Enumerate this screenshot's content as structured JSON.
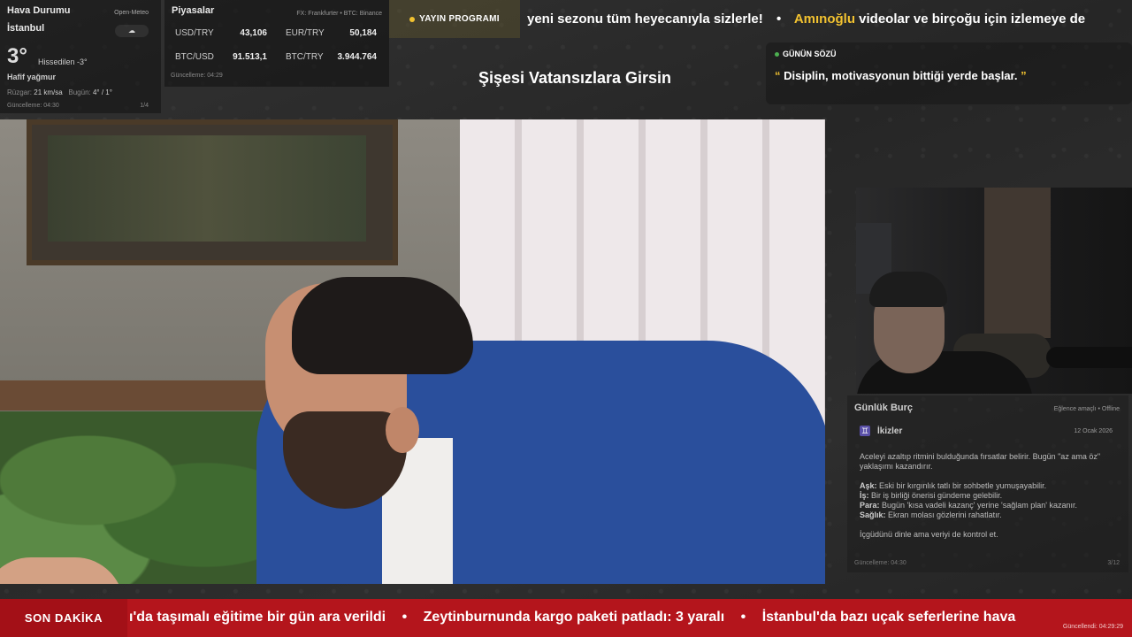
{
  "weather": {
    "title": "Hava Durumu",
    "source": "Open-Meteo",
    "city": "İstanbul",
    "condition_icon": "rain-cloud-icon",
    "temp": "3°",
    "feels_like": "Hissedilen -3°",
    "description": "Hafif yağmur",
    "wind_label": "Rüzgar:",
    "wind_value": "21 km/sa",
    "today_label": "Bugün:",
    "today_value": "4° / 1°",
    "updated": "Güncelleme: 04:30",
    "page": "1/4"
  },
  "markets": {
    "title": "Piyasalar",
    "source": "FX: Frankfurter • BTC: Binance",
    "rows": [
      {
        "label": "USD/TRY",
        "value": "43,106"
      },
      {
        "label": "EUR/TRY",
        "value": "50,184"
      },
      {
        "label": "BTC/USD",
        "value": "91.513,1"
      },
      {
        "label": "BTC/TRY",
        "value": "3.944.764"
      }
    ],
    "updated": "Güncelleme: 04:29"
  },
  "program_button": {
    "label": "YAYIN PROGRAMI"
  },
  "top_ticker": {
    "item1": "yeni sezonu tüm heyecanıyla sizlerle!",
    "separator": "•",
    "item2_highlight": "Amınoğlu",
    "item2_rest": " videolar ve birçoğu için izlemeye de"
  },
  "stream_title": "Şişesi Vatansızlara Girsin",
  "quote": {
    "header": "GÜNÜN SÖZÜ",
    "open_mark": "“",
    "text": " Disiplin, motivasyonun bittiği yerde başlar. ",
    "close_mark": "”"
  },
  "horoscope": {
    "title": "Günlük Burç",
    "mode": "Eğlence amaçlı • Offline",
    "sign_icon": "gemini-icon",
    "sign_glyph": "♊",
    "sign": "İkizler",
    "date": "12 Ocak 2026",
    "intro": "Aceleyi azaltıp ritmini bulduğunda fırsatlar belirir. Bugün \"az ama öz\" yaklaşımı kazandırır.",
    "love_label": "Aşk:",
    "love": " Eski bir kırgınlık tatlı bir sohbetle yumuşayabilir.",
    "work_label": "İş:",
    "work": " Bir iş birliği önerisi gündeme gelebilir.",
    "money_label": "Para:",
    "money": " Bugün 'kısa vadeli kazanç' yerine 'sağlam plan' kazanır.",
    "health_label": "Sağlık:",
    "health": " Ekran molası gözlerini rahatlatır.",
    "advice": "İçgüdünü dinle ama veriyi de kontrol et.",
    "updated": "Güncelleme: 04:30",
    "page": "3/12"
  },
  "breaking": {
    "label": "SON DAKİKA",
    "item1": "ı'da taşımalı eğitime bir gün ara verildi",
    "separator": "•",
    "item2": "Zeytinburnunda kargo paketi patladı: 3 yaralı",
    "item3": "İstanbul'da bazı uçak seferlerine hava",
    "updated": "Güncellendi: 04:29:29"
  }
}
